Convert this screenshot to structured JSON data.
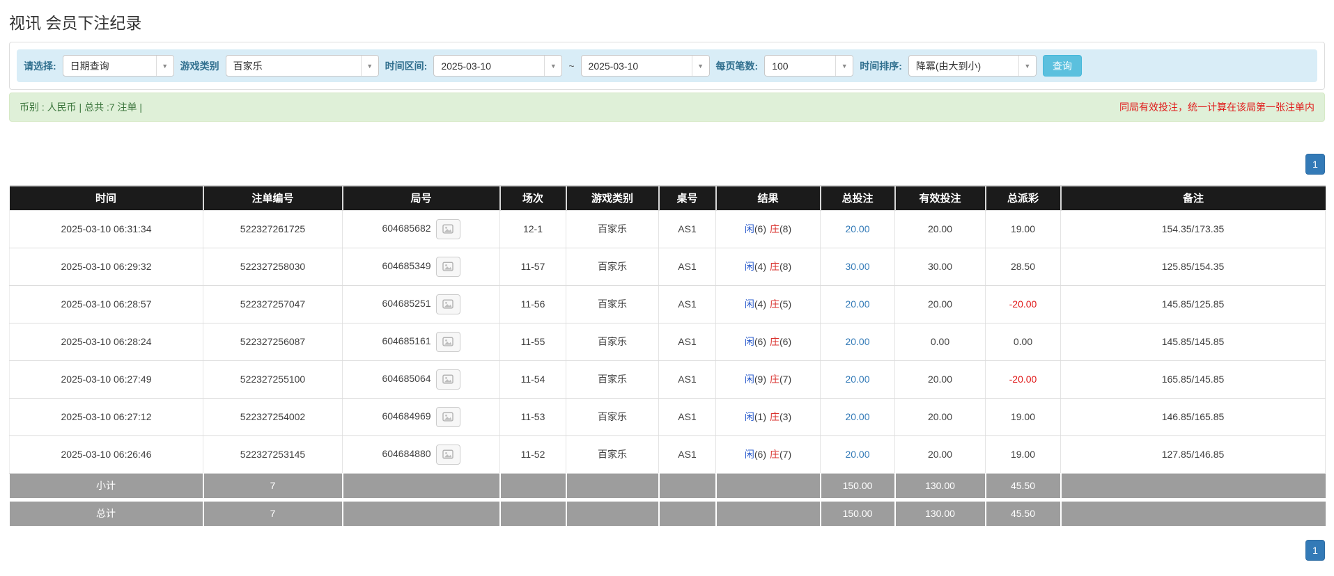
{
  "page": {
    "title": "视讯 会员下注纪录"
  },
  "filters": {
    "select_label": "请选择:",
    "select_value": "日期查询",
    "game_type_label": "游戏类别",
    "game_type_value": "百家乐",
    "date_range_label": "时间区间:",
    "date_from": "2025-03-10",
    "date_separator": "~",
    "date_to": "2025-03-10",
    "page_size_label": "每页笔数:",
    "page_size_value": "100",
    "sort_label": "时间排序:",
    "sort_value": "降冪(由大到小)",
    "query_button": "查询"
  },
  "summary": {
    "left_text": "币别 : 人民币 | 总共 :7 注单 |",
    "right_notice": "同局有效投注，统一计算在该局第一张注单内"
  },
  "pagination": {
    "page": "1"
  },
  "table": {
    "headers": [
      "时间",
      "注单编号",
      "局号",
      "场次",
      "游戏类别",
      "桌号",
      "结果",
      "总投注",
      "有效投注",
      "总派彩",
      "备注"
    ],
    "rows": [
      {
        "time": "2025-03-10 06:31:34",
        "bet_id": "522327261725",
        "round_id": "604685682",
        "session": "12-1",
        "game": "百家乐",
        "table_no": "AS1",
        "player": "闲",
        "player_n": "(6)",
        "banker": "庄",
        "banker_n": "(8)",
        "total_bet": "20.00",
        "valid_bet": "20.00",
        "payout": "19.00",
        "remark": "154.35/173.35"
      },
      {
        "time": "2025-03-10 06:29:32",
        "bet_id": "522327258030",
        "round_id": "604685349",
        "session": "11-57",
        "game": "百家乐",
        "table_no": "AS1",
        "player": "闲",
        "player_n": "(4)",
        "banker": "庄",
        "banker_n": "(8)",
        "total_bet": "30.00",
        "valid_bet": "30.00",
        "payout": "28.50",
        "remark": "125.85/154.35"
      },
      {
        "time": "2025-03-10 06:28:57",
        "bet_id": "522327257047",
        "round_id": "604685251",
        "session": "11-56",
        "game": "百家乐",
        "table_no": "AS1",
        "player": "闲",
        "player_n": "(4)",
        "banker": "庄",
        "banker_n": "(5)",
        "total_bet": "20.00",
        "valid_bet": "20.00",
        "payout": "-20.00",
        "remark": "145.85/125.85"
      },
      {
        "time": "2025-03-10 06:28:24",
        "bet_id": "522327256087",
        "round_id": "604685161",
        "session": "11-55",
        "game": "百家乐",
        "table_no": "AS1",
        "player": "闲",
        "player_n": "(6)",
        "banker": "庄",
        "banker_n": "(6)",
        "total_bet": "20.00",
        "valid_bet": "0.00",
        "payout": "0.00",
        "remark": "145.85/145.85"
      },
      {
        "time": "2025-03-10 06:27:49",
        "bet_id": "522327255100",
        "round_id": "604685064",
        "session": "11-54",
        "game": "百家乐",
        "table_no": "AS1",
        "player": "闲",
        "player_n": "(9)",
        "banker": "庄",
        "banker_n": "(7)",
        "total_bet": "20.00",
        "valid_bet": "20.00",
        "payout": "-20.00",
        "remark": "165.85/145.85"
      },
      {
        "time": "2025-03-10 06:27:12",
        "bet_id": "522327254002",
        "round_id": "604684969",
        "session": "11-53",
        "game": "百家乐",
        "table_no": "AS1",
        "player": "闲",
        "player_n": "(1)",
        "banker": "庄",
        "banker_n": "(3)",
        "total_bet": "20.00",
        "valid_bet": "20.00",
        "payout": "19.00",
        "remark": "146.85/165.85"
      },
      {
        "time": "2025-03-10 06:26:46",
        "bet_id": "522327253145",
        "round_id": "604684880",
        "session": "11-52",
        "game": "百家乐",
        "table_no": "AS1",
        "player": "闲",
        "player_n": "(6)",
        "banker": "庄",
        "banker_n": "(7)",
        "total_bet": "20.00",
        "valid_bet": "20.00",
        "payout": "19.00",
        "remark": "127.85/146.85"
      }
    ],
    "subtotal": {
      "label": "小计",
      "count": "7",
      "total_bet": "150.00",
      "valid_bet": "130.00",
      "payout": "45.50"
    },
    "total": {
      "label": "总计",
      "count": "7",
      "total_bet": "150.00",
      "valid_bet": "130.00",
      "payout": "45.50"
    }
  },
  "colors": {
    "filter_bar_bg": "#d9edf7",
    "filter_label": "#31708f",
    "query_button_bg": "#5bc0de",
    "alert_bg": "#dff0d8",
    "alert_green_text": "#3c763d",
    "alert_red_text": "#e01818",
    "table_header_bg": "#1b1b1b",
    "summary_row_bg": "#9d9d9d",
    "pagination_active": "#337ab7",
    "player_blue": "#2b5ccc",
    "banker_red": "#d9302c",
    "bet_link_blue": "#337ab7",
    "negative_red": "#e01818"
  }
}
